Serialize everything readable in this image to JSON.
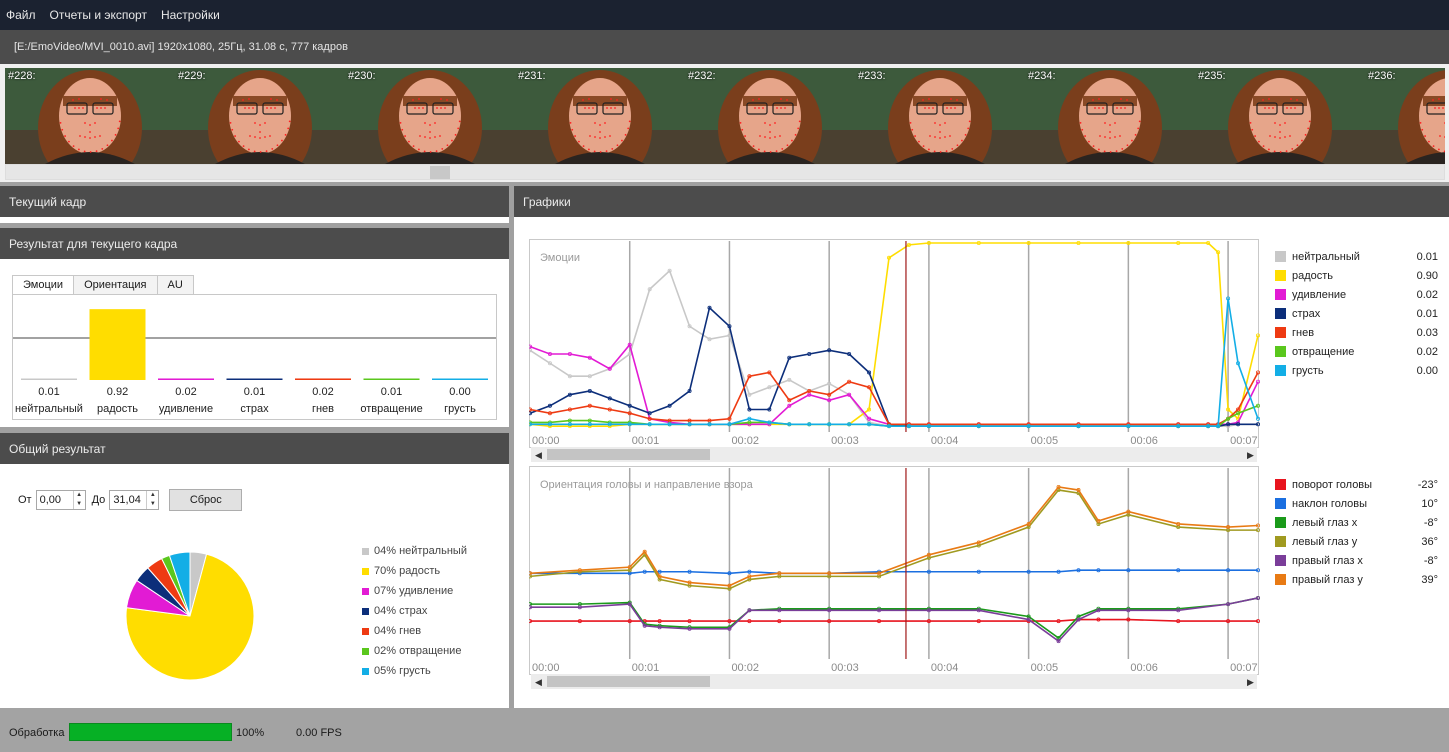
{
  "menu": [
    "Файл",
    "Отчеты и экспорт",
    "Настройки"
  ],
  "file_info": "[E:/EmoVideo/MVI_0010.avi] 1920x1080, 25Гц, 31.08 с, 777 кадров",
  "frames": [
    "#228:",
    "#229:",
    "#230:",
    "#231:",
    "#232:",
    "#233:",
    "#234:",
    "#235:",
    "#236:"
  ],
  "panels": {
    "current_frame": "Текущий кадр",
    "frame_result": "Результат для текущего кадра",
    "overall": "Общий результат",
    "graphs": "Графики"
  },
  "tabs": [
    "Эмоции",
    "Ориентация",
    "AU"
  ],
  "bar_chart": {
    "categories": [
      "нейтральный",
      "радость",
      "удивление",
      "страх",
      "гнев",
      "отвращение",
      "грусть"
    ],
    "values": [
      "0.01",
      "0.92",
      "0.02",
      "0.01",
      "0.02",
      "0.01",
      "0.00"
    ],
    "colors": [
      "#c8c8c8",
      "#ffdd00",
      "#e21bd4",
      "#0c2e7a",
      "#ee3a12",
      "#5ac71d",
      "#13aee6"
    ]
  },
  "range": {
    "from_label": "От",
    "from_value": "0,00",
    "to_label": "До",
    "to_value": "31,04",
    "reset": "Сброс"
  },
  "chart_data": [
    {
      "type": "bar",
      "categories": [
        "нейтральный",
        "радость",
        "удивление",
        "страх",
        "гнев",
        "отвращение",
        "грусть"
      ],
      "values": [
        0.01,
        0.92,
        0.02,
        0.01,
        0.02,
        0.01,
        0.0
      ],
      "ylim": [
        0,
        1
      ]
    },
    {
      "type": "pie",
      "labels": [
        "04% нейтральный",
        "70% радость",
        "07% удивление",
        "04% страх",
        "04% гнев",
        "02% отвращение",
        "05% грусть"
      ],
      "values": [
        4,
        70,
        7,
        4,
        4,
        2,
        5
      ],
      "colors": [
        "#c8c8c8",
        "#ffdd00",
        "#e21bd4",
        "#0c2e7a",
        "#ee3a12",
        "#5ac71d",
        "#13aee6"
      ],
      "legend": "right"
    },
    {
      "type": "line",
      "title": "Эмоции",
      "x_ticks": [
        "00:00",
        "00:01",
        "00:02",
        "00:03",
        "00:04",
        "00:05",
        "00:06",
        "00:07"
      ],
      "x": [
        0,
        0.2,
        0.4,
        0.6,
        0.8,
        1.0,
        1.2,
        1.4,
        1.6,
        1.8,
        2.0,
        2.2,
        2.4,
        2.6,
        2.8,
        3.0,
        3.2,
        3.4,
        3.6,
        3.8,
        4.0,
        4.5,
        5.0,
        5.5,
        6.0,
        6.5,
        6.8,
        6.9,
        7.0,
        7.1,
        7.3
      ],
      "ylim": [
        0,
        1
      ],
      "series": [
        {
          "name": "нейтральный",
          "color": "#c8c8c8",
          "values": [
            0.42,
            0.35,
            0.28,
            0.28,
            0.32,
            0.4,
            0.75,
            0.85,
            0.55,
            0.48,
            0.5,
            0.18,
            0.22,
            0.26,
            0.2,
            0.24,
            0.18,
            0.03,
            0.01,
            0.01,
            0.01,
            0.01,
            0.01,
            0.01,
            0.01,
            0.01,
            0.01,
            0.01,
            0.01,
            0.02,
            0.02
          ]
        },
        {
          "name": "радость",
          "color": "#ffdd00",
          "values": [
            0.02,
            0.01,
            0.01,
            0.01,
            0.01,
            0.02,
            0.02,
            0.02,
            0.02,
            0.02,
            0.02,
            0.02,
            0.02,
            0.02,
            0.02,
            0.02,
            0.02,
            0.1,
            0.92,
            0.99,
            1.0,
            1.0,
            1.0,
            1.0,
            1.0,
            1.0,
            1.0,
            0.95,
            0.1,
            0.05,
            0.5
          ]
        },
        {
          "name": "удивление",
          "color": "#e21bd4",
          "values": [
            0.44,
            0.4,
            0.4,
            0.38,
            0.32,
            0.45,
            0.05,
            0.03,
            0.02,
            0.02,
            0.02,
            0.02,
            0.02,
            0.12,
            0.18,
            0.15,
            0.18,
            0.05,
            0.02,
            0.02,
            0.02,
            0.02,
            0.02,
            0.02,
            0.02,
            0.02,
            0.02,
            0.02,
            0.02,
            0.03,
            0.25
          ]
        },
        {
          "name": "страх",
          "color": "#0c2e7a",
          "values": [
            0.08,
            0.12,
            0.18,
            0.2,
            0.16,
            0.12,
            0.08,
            0.12,
            0.2,
            0.65,
            0.55,
            0.1,
            0.1,
            0.38,
            0.4,
            0.42,
            0.4,
            0.3,
            0.02,
            0.01,
            0.01,
            0.01,
            0.01,
            0.01,
            0.01,
            0.01,
            0.01,
            0.01,
            0.02,
            0.02,
            0.02
          ]
        },
        {
          "name": "гнев",
          "color": "#ee3a12",
          "values": [
            0.1,
            0.08,
            0.1,
            0.12,
            0.1,
            0.08,
            0.05,
            0.04,
            0.04,
            0.04,
            0.05,
            0.28,
            0.3,
            0.15,
            0.2,
            0.18,
            0.25,
            0.22,
            0.02,
            0.02,
            0.02,
            0.02,
            0.02,
            0.02,
            0.02,
            0.02,
            0.02,
            0.02,
            0.05,
            0.1,
            0.3
          ]
        },
        {
          "name": "отвращение",
          "color": "#5ac71d",
          "values": [
            0.03,
            0.03,
            0.04,
            0.04,
            0.03,
            0.03,
            0.02,
            0.02,
            0.02,
            0.02,
            0.02,
            0.03,
            0.03,
            0.02,
            0.02,
            0.02,
            0.02,
            0.02,
            0.01,
            0.01,
            0.01,
            0.01,
            0.01,
            0.01,
            0.01,
            0.01,
            0.01,
            0.01,
            0.05,
            0.08,
            0.12
          ]
        },
        {
          "name": "грусть",
          "color": "#13aee6",
          "values": [
            0.02,
            0.02,
            0.02,
            0.02,
            0.02,
            0.02,
            0.02,
            0.02,
            0.02,
            0.02,
            0.02,
            0.05,
            0.03,
            0.02,
            0.02,
            0.02,
            0.02,
            0.02,
            0.01,
            0.01,
            0.01,
            0.01,
            0.01,
            0.01,
            0.01,
            0.01,
            0.01,
            0.01,
            0.7,
            0.35,
            0.05
          ]
        }
      ]
    },
    {
      "type": "line",
      "title": "Ориентация головы и направление взора",
      "x_ticks": [
        "00:00",
        "00:01",
        "00:02",
        "00:03",
        "00:04",
        "00:05",
        "00:06",
        "00:07"
      ],
      "x": [
        0,
        0.5,
        1.0,
        1.15,
        1.3,
        1.6,
        2.0,
        2.2,
        2.5,
        3.0,
        3.5,
        4.0,
        4.5,
        5.0,
        5.3,
        5.5,
        5.7,
        6.0,
        6.5,
        7.0,
        7.3
      ],
      "ylim": [
        -45,
        75
      ],
      "series": [
        {
          "name": "поворот головы",
          "color": "#e8141e",
          "values": [
            -23,
            -23,
            -23,
            -23,
            -23,
            -23,
            -23,
            -23,
            -23,
            -23,
            -23,
            -23,
            -23,
            -23,
            -23,
            -22,
            -22,
            -22,
            -23,
            -23,
            -23
          ]
        },
        {
          "name": "наклон головы",
          "color": "#1b6fe0",
          "values": [
            8,
            8,
            8,
            9,
            9,
            9,
            8,
            9,
            8,
            8,
            9,
            9,
            9,
            9,
            9,
            10,
            10,
            10,
            10,
            10,
            10
          ]
        },
        {
          "name": "левый глаз x",
          "color": "#1a9a1a",
          "values": [
            -12,
            -12,
            -11,
            -25,
            -26,
            -27,
            -27,
            -16,
            -15,
            -15,
            -15,
            -15,
            -15,
            -20,
            -34,
            -20,
            -15,
            -15,
            -15,
            -12,
            -8
          ]
        },
        {
          "name": "левый глаз y",
          "color": "#a09a20",
          "values": [
            6,
            9,
            10,
            20,
            4,
            0,
            -2,
            4,
            6,
            6,
            6,
            18,
            26,
            38,
            62,
            60,
            40,
            46,
            38,
            36,
            36
          ]
        },
        {
          "name": "правый глаз x",
          "color": "#7a3d99",
          "values": [
            -14,
            -14,
            -12,
            -26,
            -27,
            -28,
            -28,
            -16,
            -16,
            -16,
            -16,
            -16,
            -16,
            -22,
            -36,
            -22,
            -16,
            -16,
            -16,
            -12,
            -8
          ]
        },
        {
          "name": "правый глаз y",
          "color": "#e87a14",
          "values": [
            8,
            10,
            12,
            22,
            6,
            2,
            0,
            6,
            8,
            8,
            8,
            20,
            28,
            40,
            64,
            62,
            42,
            48,
            40,
            38,
            39
          ]
        }
      ]
    }
  ],
  "emotion_legend": [
    {
      "name": "нейтральный",
      "value": "0.01",
      "color": "#c8c8c8"
    },
    {
      "name": "радость",
      "value": "0.90",
      "color": "#ffdd00"
    },
    {
      "name": "удивление",
      "value": "0.02",
      "color": "#e21bd4"
    },
    {
      "name": "страх",
      "value": "0.01",
      "color": "#0c2e7a"
    },
    {
      "name": "гнев",
      "value": "0.03",
      "color": "#ee3a12"
    },
    {
      "name": "отвращение",
      "value": "0.02",
      "color": "#5ac71d"
    },
    {
      "name": "грусть",
      "value": "0.00",
      "color": "#13aee6"
    }
  ],
  "orientation_legend": [
    {
      "name": "поворот головы",
      "value": "-23°",
      "color": "#e8141e"
    },
    {
      "name": "наклон головы",
      "value": "10°",
      "color": "#1b6fe0"
    },
    {
      "name": "левый глаз x",
      "value": "-8°",
      "color": "#1a9a1a"
    },
    {
      "name": "левый глаз y",
      "value": "36°",
      "color": "#a09a20"
    },
    {
      "name": "правый глаз x",
      "value": "-8°",
      "color": "#7a3d99"
    },
    {
      "name": "правый глаз y",
      "value": "39°",
      "color": "#e87a14"
    }
  ],
  "pie_legend": [
    "04% нейтральный",
    "70% радость",
    "07% удивление",
    "04% страх",
    "04% гнев",
    "02% отвращение",
    "05% грусть"
  ],
  "status": {
    "label": "Обработка",
    "progress": 1.0,
    "percent": "100%",
    "fps": "0.00 FPS"
  },
  "colors": {
    "menubar": "#1b2230",
    "panel_head": "#4c4c4c",
    "progress": "#06b025",
    "cursor": "#a01818"
  }
}
